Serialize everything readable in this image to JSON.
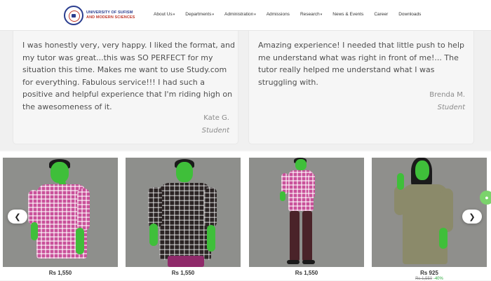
{
  "header": {
    "logo": {
      "line1": "UNIVERSITY OF SUFISM",
      "line2": "AND MODERN SCIENCES"
    },
    "nav": [
      {
        "label": "About Us",
        "dropdown": true
      },
      {
        "label": "Departments",
        "dropdown": true
      },
      {
        "label": "Administration",
        "dropdown": true
      },
      {
        "label": "Admissions",
        "dropdown": false
      },
      {
        "label": "Research",
        "dropdown": true
      },
      {
        "label": "News & Events",
        "dropdown": false
      },
      {
        "label": "Career",
        "dropdown": false
      },
      {
        "label": "Downloads",
        "dropdown": false
      }
    ]
  },
  "testimonials": [
    {
      "quote": "I was honestly very, very happy. I liked the format, and my tutor was great...this was SO PERFECT for my situation this time. Makes me want to use Study.com for everything. Fabulous service!!! I had such a positive and helpful experience that I'm riding high on the awesomeness of it.",
      "author": "Kate G.",
      "role": "Student"
    },
    {
      "quote": "Amazing experience! I needed that little push to help me understand what was right in front of me!... The tutor really helped me understand what I was struggling with.",
      "author": "Brenda M.",
      "role": "Student"
    }
  ],
  "products": [
    {
      "price": "Rs 1,550",
      "shirt": "pink-check"
    },
    {
      "price": "Rs 1,550",
      "shirt": "dark-check"
    },
    {
      "price": "Rs 1,550",
      "shirt": "pink-check"
    },
    {
      "price": "Rs 925",
      "shirt": "khaki",
      "old_price": "Rs 1,550",
      "discount": "-40%"
    }
  ],
  "carousel": {
    "prev_icon": "chevron-left-icon",
    "next_icon": "chevron-right-icon"
  },
  "colors": {
    "brand_blue": "#2a3d8f",
    "brand_red": "#c0392b",
    "discount_green": "#2eaa3f"
  }
}
